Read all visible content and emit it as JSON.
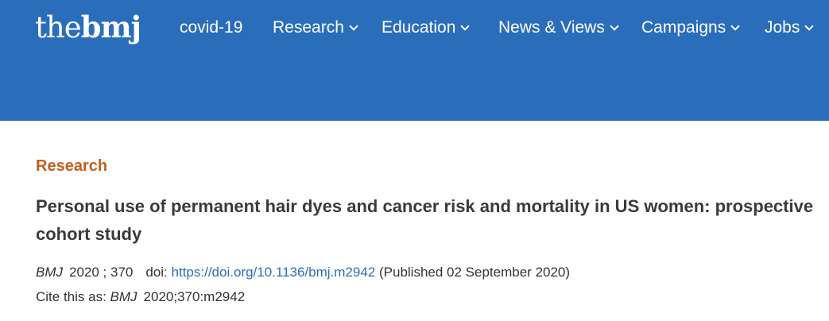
{
  "header": {
    "logo": {
      "the": "the",
      "bmj": "bmj"
    },
    "nav": [
      {
        "label": "covid-19",
        "has_dropdown": false
      },
      {
        "label": "Research",
        "has_dropdown": true
      },
      {
        "label": "Education",
        "has_dropdown": true
      },
      {
        "label": "News & Views",
        "has_dropdown": true
      },
      {
        "label": "Campaigns",
        "has_dropdown": true
      },
      {
        "label": "Jobs",
        "has_dropdown": true
      }
    ],
    "dropdown_icon": "chevron-down-icon",
    "background_color": "#2a6ebb"
  },
  "article": {
    "section": "Research",
    "section_color": "#c2601c",
    "title": "Personal use of permanent hair dyes and cancer risk and mortality in US women: prospective cohort study",
    "citation": {
      "journal": "BMJ",
      "year_volume": "2020 ; 370",
      "doi_label": "doi:",
      "doi_url": "https://doi.org/10.1136/bmj.m2942",
      "published": "(Published 02 September 2020)"
    },
    "cite_as": {
      "label": "Cite this as:",
      "journal": "BMJ",
      "reference": "2020;370:m2942"
    }
  }
}
